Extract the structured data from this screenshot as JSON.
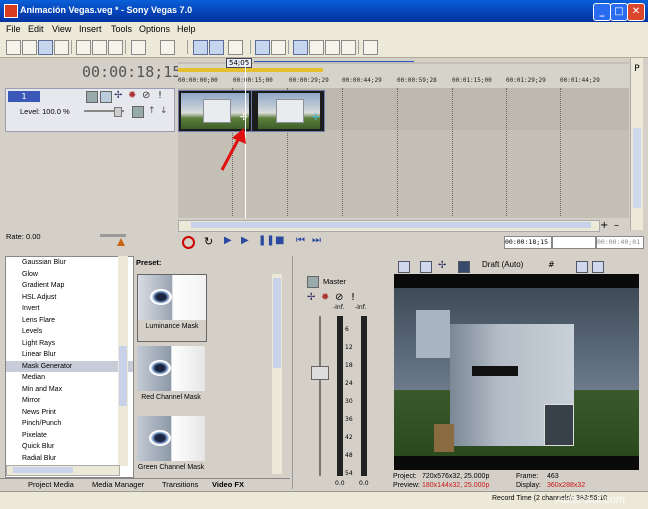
{
  "window": {
    "title": "Animación Vegas.veg * - Sony Vegas 7.0",
    "min": "_",
    "max": "□",
    "close": "✕"
  },
  "menu": [
    "File",
    "Edit",
    "View",
    "Insert",
    "Tools",
    "Options",
    "Help"
  ],
  "timecode": "00:00:18;15",
  "track": {
    "number": "1",
    "level_label": "Level: 100.0 %"
  },
  "ruler": {
    "loop_label": "54;05",
    "ticks": [
      "00:00:00;00",
      "00:00:15;00",
      "00:00:29;29",
      "00:00:44;29",
      "00:00:59;28",
      "00:01:15;00",
      "00:01:29;29",
      "00:01:44;29"
    ]
  },
  "rate": "Rate: 0.00",
  "transport": {
    "position": "00:00:18;15",
    "end": "00:00:40;01"
  },
  "fx_list": [
    "Gaussian Blur",
    "Glow",
    "Gradient Map",
    "HSL Adjust",
    "Invert",
    "Lens Flare",
    "Levels",
    "Light Rays",
    "Linear Blur",
    "Mask Generator",
    "Median",
    "Min and Max",
    "Mirror",
    "News Print",
    "Pinch/Punch",
    "Pixelate",
    "Quick Blur",
    "Radial Blur"
  ],
  "fx_selected": "Mask Generator",
  "preset_label": "Preset:",
  "presets": [
    "Luminance Mask",
    "Red Channel Mask",
    "Green Channel Mask"
  ],
  "tabs": [
    "Project Media",
    "Media Manager",
    "Transitions",
    "Video FX"
  ],
  "mixer": {
    "master": "Master",
    "left_db": "-Inf.",
    "right_db": "-Inf.",
    "scale": [
      "6",
      "12",
      "18",
      "24",
      "30",
      "36",
      "42",
      "48",
      "54"
    ],
    "left_val": "0.0",
    "right_val": "0.0"
  },
  "preview": {
    "quality": "Draft (Auto)",
    "project_label": "Project:",
    "project_value": "720x576x32, 25.000p",
    "preview_label": "Preview:",
    "preview_value": "180x144x32, 25.000p",
    "frame_label": "Frame:",
    "frame_value": "463",
    "display_label": "Display:",
    "display_value": "360x288x32"
  },
  "status": "Record Time (2 channels): 383:56:10",
  "watermark": "AulaFacil.com"
}
